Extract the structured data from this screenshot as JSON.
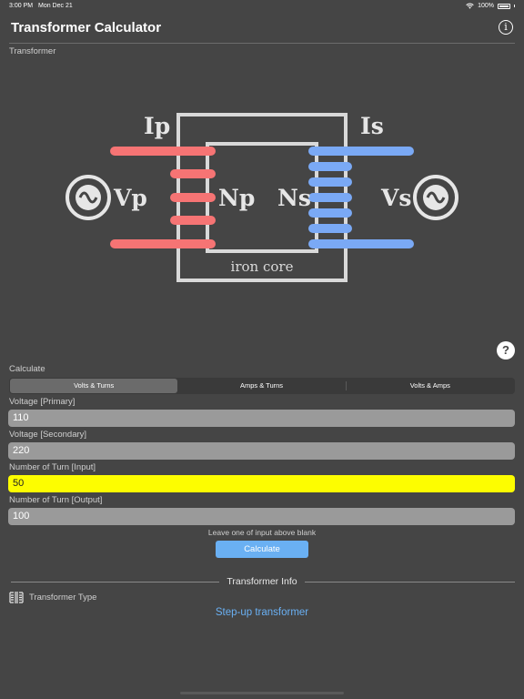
{
  "status_bar": {
    "time": "3:00 PM",
    "date": "Mon Dec 21",
    "battery": "100%"
  },
  "header": {
    "title": "Transformer Calculator"
  },
  "diagram": {
    "section_label": "Transformer",
    "labels": {
      "ip": "Ip",
      "is": "Is",
      "vp": "Vp",
      "vs": "Vs",
      "np": "Np",
      "ns": "Ns",
      "core": "iron core"
    },
    "colors": {
      "primary": "#f67474",
      "secondary": "#7aa9f5",
      "core": "#d9d9d9"
    }
  },
  "calculate": {
    "section_label": "Calculate",
    "tabs": [
      {
        "label": "Volts & Turns",
        "active": true
      },
      {
        "label": "Amps & Turns",
        "active": false
      },
      {
        "label": "Volts & Amps",
        "active": false
      }
    ]
  },
  "fields": [
    {
      "label": "Voltage [Primary]",
      "value": "110",
      "highlighted": false
    },
    {
      "label": "Voltage [Secondary]",
      "value": "220",
      "highlighted": false
    },
    {
      "label": "Number of Turn [Input]",
      "value": "50",
      "highlighted": true
    },
    {
      "label": "Number of Turn [Output]",
      "value": "100",
      "highlighted": false
    }
  ],
  "hint": "Leave one of input above blank",
  "calculate_button": "Calculate",
  "info": {
    "header": "Transformer Info",
    "type_label": "Transformer Type",
    "result": "Step-up transformer"
  },
  "colors": {
    "background": "#454545",
    "accent": "#6ab0f3",
    "highlight": "#fdfd00"
  }
}
